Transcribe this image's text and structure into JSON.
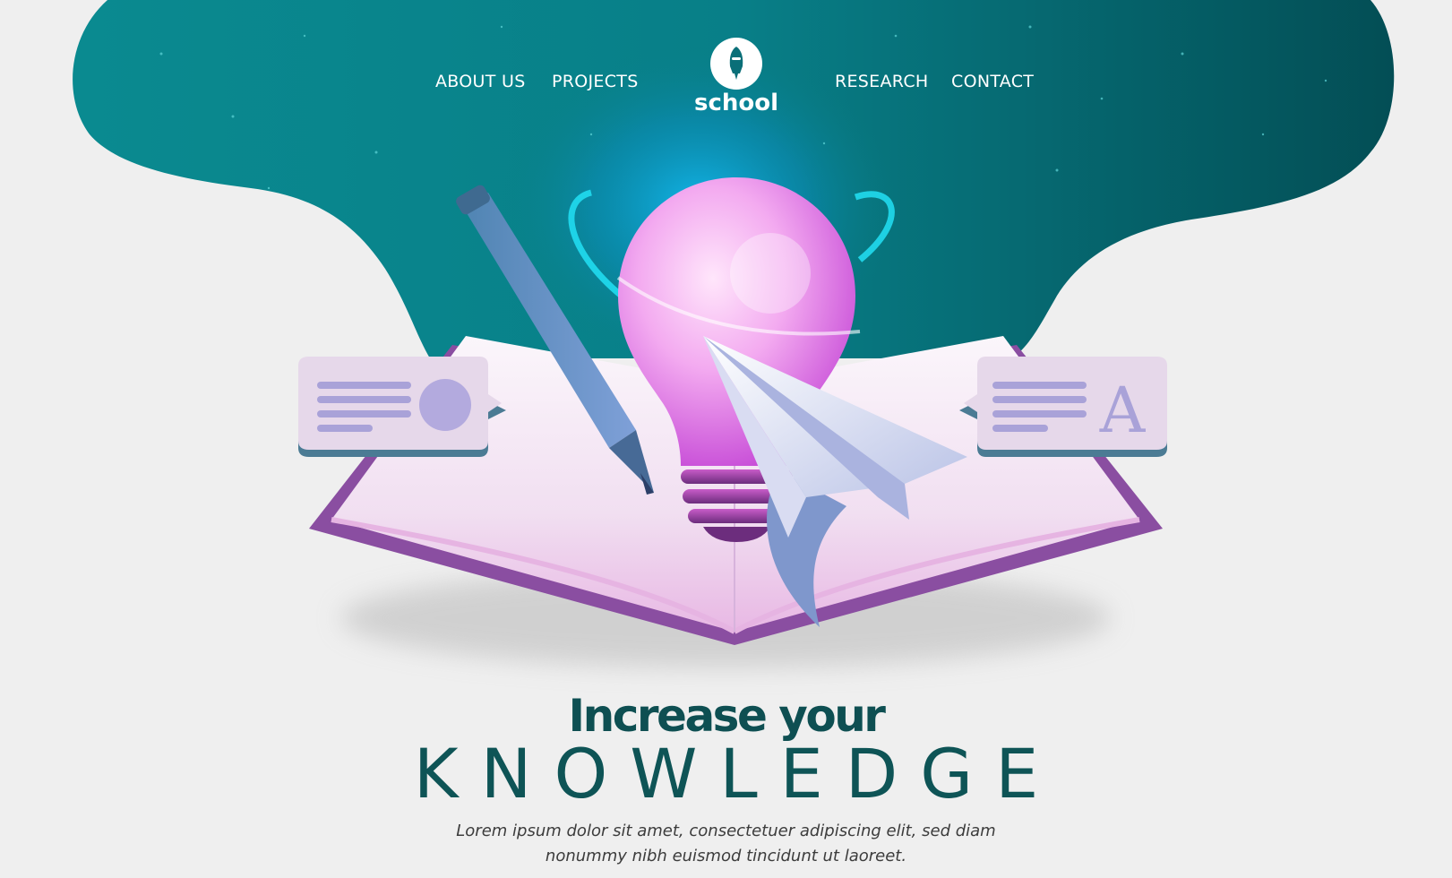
{
  "nav": {
    "about": "ABOUT US",
    "projects": "PROJECTS",
    "research": "RESEARCH",
    "contact": "CONTACT"
  },
  "logo": {
    "text": "school",
    "icon": "rocket-icon"
  },
  "hero": {
    "headline": "Increase your",
    "subhead": "KNOWLEDGE",
    "body": "Lorem ipsum dolor sit amet, consectetuer adipiscing elit, sed diam nonummy nibh euismod tincidunt ut laoreet."
  },
  "cards": {
    "right_letter": "A"
  },
  "illustration": {
    "items": [
      "open-book-icon",
      "lightbulb-icon",
      "pencil-icon",
      "paper-plane-icon"
    ]
  },
  "colors": {
    "background": "#efefef",
    "header_teal": "#0a7d85",
    "header_dark": "#024e55",
    "headline": "#0e4f52",
    "book_purple": "#8a4ea1",
    "bulb_pink": "#e98ee8",
    "card_bg": "#e6d8ea",
    "card_lines": "#a9a2d8"
  }
}
